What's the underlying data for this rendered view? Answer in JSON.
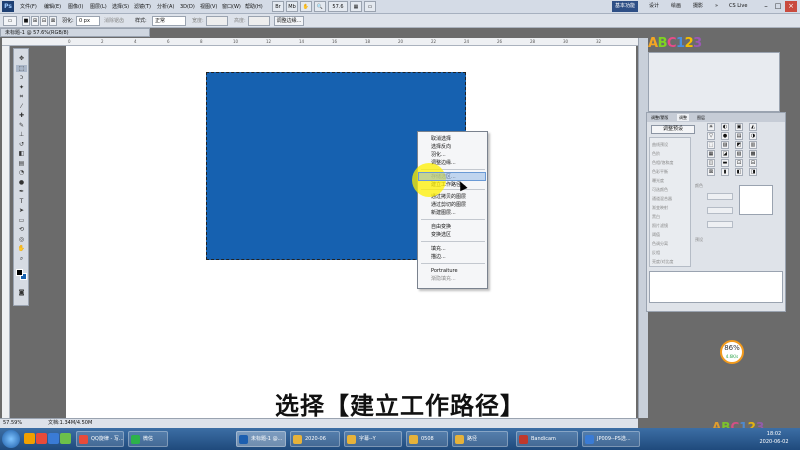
{
  "menubar": {
    "app_logo": "Ps",
    "items": [
      "文件(F)",
      "编辑(E)",
      "图像(I)",
      "图层(L)",
      "选择(S)",
      "滤镜(T)",
      "分析(A)",
      "3D(D)",
      "视图(V)",
      "窗口(W)",
      "帮助(H)"
    ],
    "zoom": "57.6",
    "workspaces": [
      "基本功能",
      "设计",
      "绘画",
      "摄影"
    ],
    "more": "»",
    "cs_live": "CS Live"
  },
  "optionsbar": {
    "feather_label": "羽化:",
    "feather_value": "0 px",
    "antialias": "消除锯齿",
    "style_label": "样式:",
    "style_value": "正常",
    "width_label": "宽度:",
    "height_label": "高度:",
    "refine_edge": "调整边缘..."
  },
  "document": {
    "tab_title": "未标题-1 @ 57.6%(RGB/8)",
    "status": "57.59%",
    "doc_size": "文档:1.34M/4.50M"
  },
  "ruler": {
    "top_ticks": [
      "0",
      "2",
      "4",
      "6",
      "8",
      "10",
      "12",
      "14",
      "16",
      "18",
      "20",
      "22",
      "24",
      "26",
      "28",
      "30",
      "32"
    ]
  },
  "context_menu": {
    "items": [
      {
        "label": "取消选择",
        "disabled": false
      },
      {
        "label": "选择反向",
        "disabled": false
      },
      {
        "label": "羽化...",
        "disabled": false
      },
      {
        "label": "调整边缘...",
        "disabled": false
      },
      {
        "label": "存储选区...",
        "disabled": false
      },
      {
        "label": "建立工作路径...",
        "disabled": false
      },
      {
        "label": "通过拷贝的图层",
        "disabled": false
      },
      {
        "label": "通过剪切的图层",
        "disabled": false
      },
      {
        "label": "新建图层...",
        "disabled": false
      },
      {
        "label": "自由变换",
        "disabled": false
      },
      {
        "label": "变换选区",
        "disabled": false
      },
      {
        "label": "填充...",
        "disabled": false
      },
      {
        "label": "描边...",
        "disabled": false
      },
      {
        "label": "Portraiture",
        "disabled": false
      },
      {
        "label": "渐隐填充...",
        "disabled": true
      }
    ]
  },
  "caption": "选择【建立工作路径】",
  "adjust_panel": {
    "tabs": [
      "调整/蒙版",
      "调整",
      "图层"
    ],
    "preset_button": "调整预设",
    "list_rows": [
      "曲线预设",
      "色阶",
      "色相/饱和度",
      "色彩平衡",
      "曝光度",
      "可选颜色",
      "通道混合器",
      "渐变映射",
      "黑白",
      "照片滤镜",
      "阈值",
      "色调分离",
      "反相",
      "亮度/对比度"
    ],
    "field_label": "颜色",
    "checkbox_label": "预设"
  },
  "brand": {
    "logo_text": "ABC123",
    "logo_colors": [
      "#f5a623",
      "#7ed321",
      "#e84b8a",
      "#4a90e2",
      "#f8c000",
      "#9b59b6"
    ]
  },
  "widget": {
    "percent": "86%",
    "sub": "4.6K/s"
  },
  "taskbar": {
    "buttons": [
      {
        "label": "QQ旋律 - 写...",
        "color": "#e84b3a"
      },
      {
        "label": "微信",
        "color": "#2db24a"
      },
      {
        "label": "未标题-1 @...",
        "color": "#1c5fb0"
      },
      {
        "label": "2020-06",
        "color": "#e6b23a"
      },
      {
        "label": "字幕--Y",
        "color": "#e6b23a"
      },
      {
        "label": "0508",
        "color": "#e6b23a"
      },
      {
        "label": "路径",
        "color": "#e6b23a"
      },
      {
        "label": "Bandicam",
        "color": "#c0392b"
      },
      {
        "label": "JP009--PS选...",
        "color": "#3a7bd5"
      }
    ],
    "time": "18:02",
    "date": "2020-06-02"
  },
  "colors": {
    "fill": "#1661b0",
    "highlight": "#fff000"
  }
}
